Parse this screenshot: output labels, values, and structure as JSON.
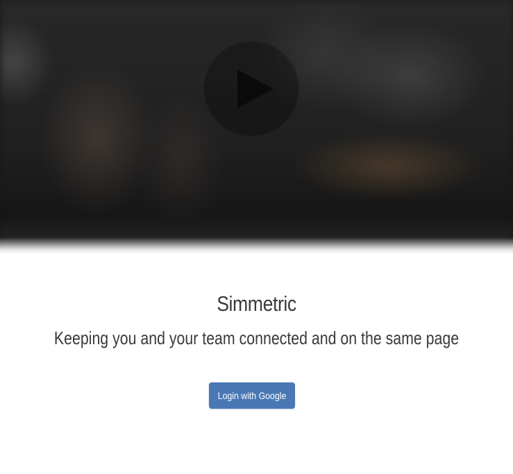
{
  "hero": {
    "play_icon": "play-icon"
  },
  "brand": {
    "title": "Simmetric",
    "tagline": "Keeping you and your team connected and on the same page"
  },
  "actions": {
    "login_label": "Login with Google"
  },
  "colors": {
    "accent": "#4a78b5",
    "text": "#3a3a3a",
    "background": "#ffffff"
  }
}
